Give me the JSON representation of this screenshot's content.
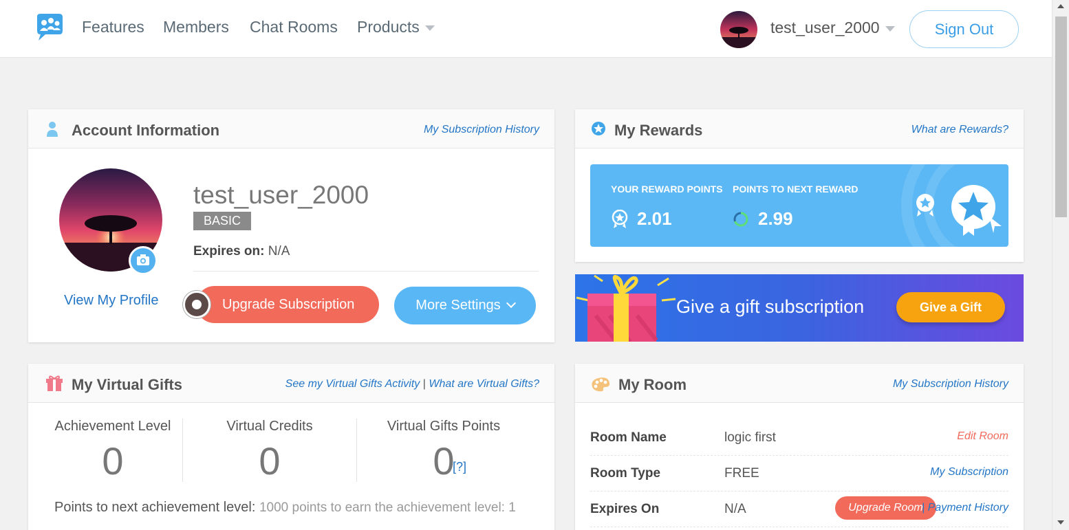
{
  "nav": {
    "links": [
      "Features",
      "Members",
      "Chat Rooms",
      "Products"
    ],
    "username": "test_user_2000",
    "signout_label": "Sign Out"
  },
  "account": {
    "title": "Account Information",
    "history_link": "My Subscription History",
    "view_profile": "View My Profile",
    "username": "test_user_2000",
    "plan": "BASIC",
    "expires_label": "Expires on:",
    "expires_value": "N/A",
    "upgrade_label": "Upgrade Subscription",
    "more_label": "More Settings"
  },
  "rewards": {
    "title": "My Rewards",
    "link": "What are Rewards?",
    "points_label": "YOUR REWARD POINTS",
    "points_value": "2.01",
    "next_label": "POINTS TO NEXT REWARD",
    "next_value": "2.99"
  },
  "gift_banner": {
    "text": "Give a gift subscription",
    "button": "Give a Gift"
  },
  "virtual_gifts": {
    "title": "My Virtual Gifts",
    "activity_link": "See my Virtual Gifts Activity",
    "separator": "|",
    "what_link": "What are Virtual Gifts?",
    "cols": [
      {
        "label": "Achievement Level",
        "value": "0"
      },
      {
        "label": "Virtual Credits",
        "value": "0"
      },
      {
        "label": "Virtual Gifts Points",
        "value": "0"
      }
    ],
    "help": "[?]",
    "next_label": "Points to next achievement level:",
    "next_value": "1000 points to earn the achievement level: 1"
  },
  "room": {
    "title": "My Room",
    "history_link": "My Subscription History",
    "rows": [
      {
        "key": "Room Name",
        "value": "logic first",
        "action": "Edit Room"
      },
      {
        "key": "Room Type",
        "value": "FREE",
        "action": "My Subscription"
      },
      {
        "key": "Expires On",
        "value": "N/A",
        "action": "| Payment History"
      }
    ],
    "upgrade_label": "Upgrade Room"
  },
  "colors": {
    "accent_blue": "#5cb8f4",
    "link_blue": "#2376c6",
    "coral": "#f26a5a",
    "gift_orange": "#f7a30f"
  }
}
